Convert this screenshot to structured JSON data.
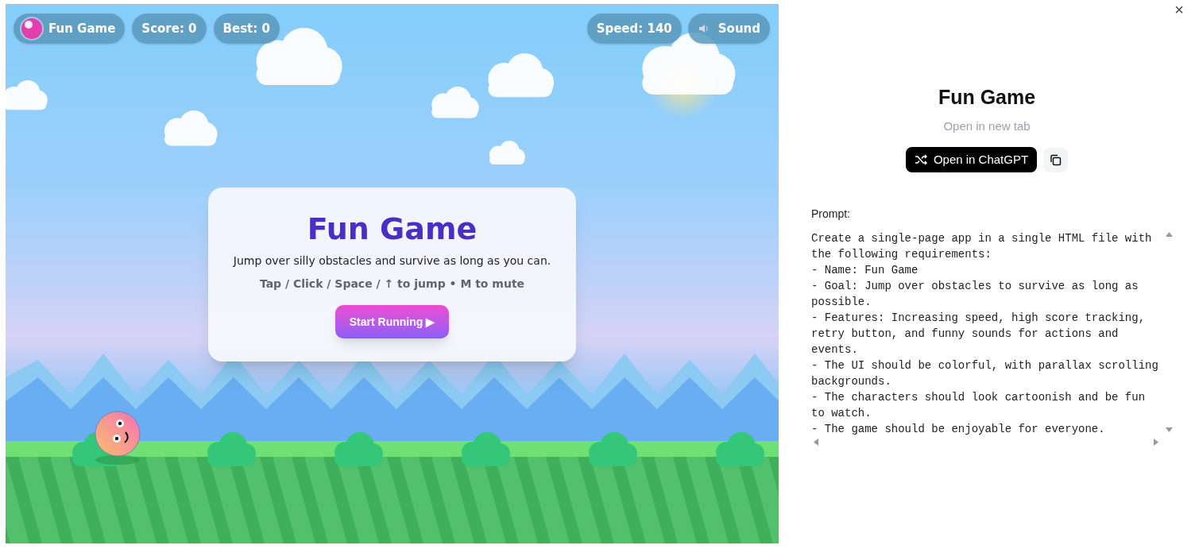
{
  "game": {
    "hud": {
      "title": "Fun Game",
      "score": "Score: 0",
      "best": "Best: 0",
      "speed": "Speed: 140",
      "sound": "Sound"
    },
    "card": {
      "title": "Fun Game",
      "subtitle": "Jump over silly obstacles and survive as long as you can.",
      "hint": "Tap / Click / Space / ↑ to jump • M to mute",
      "button": "Start Running ▶"
    }
  },
  "panel": {
    "close": "×",
    "title": "Fun Game",
    "link": "Open in new tab",
    "open_button": "Open in ChatGPT",
    "prompt_label": "Prompt:",
    "prompt": "Create a single-page app in a single HTML file with the following requirements:\n- Name: Fun Game\n- Goal: Jump over obstacles to survive as long as possible.\n- Features: Increasing speed, high score tracking, retry button, and funny sounds for actions and events.\n- The UI should be colorful, with parallax scrolling backgrounds.\n- The characters should look cartoonish and be fun to watch.\n- The game should be enjoyable for everyone."
  }
}
